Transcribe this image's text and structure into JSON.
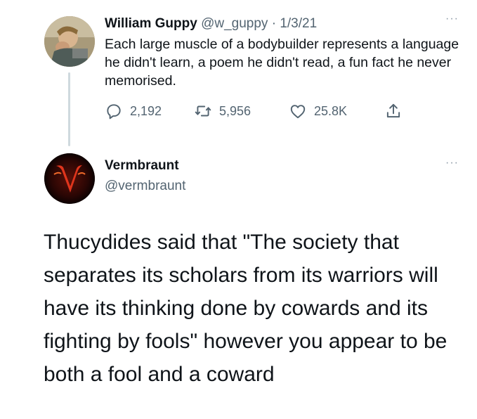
{
  "tweet1": {
    "name": "William Guppy",
    "handle": "@w_guppy",
    "separator": "·",
    "date": "1/3/21",
    "text": "Each large muscle of a bodybuilder represents a language he didn't learn, a poem he didn't read, a fun fact he never memorised.",
    "more_label": "···",
    "actions": {
      "reply_icon": "reply-icon",
      "reply_count": "2,192",
      "retweet_icon": "retweet-icon",
      "retweet_count": "5,956",
      "like_icon": "heart-icon",
      "like_count": "25.8K",
      "share_icon": "share-icon"
    }
  },
  "tweet2": {
    "name": "Vermbraunt",
    "handle": "@vermbraunt",
    "more_label": "···",
    "text": "Thucydides said that \"The society that separates its scholars from its warriors will have its thinking done by cowards and its fighting by fools\" however you appear to be both a fool and a coward"
  },
  "colors": {
    "text_primary": "#0f1419",
    "text_secondary": "#536471",
    "thread_line": "#cfd9de",
    "avatar2_accent": "#e0351c"
  }
}
